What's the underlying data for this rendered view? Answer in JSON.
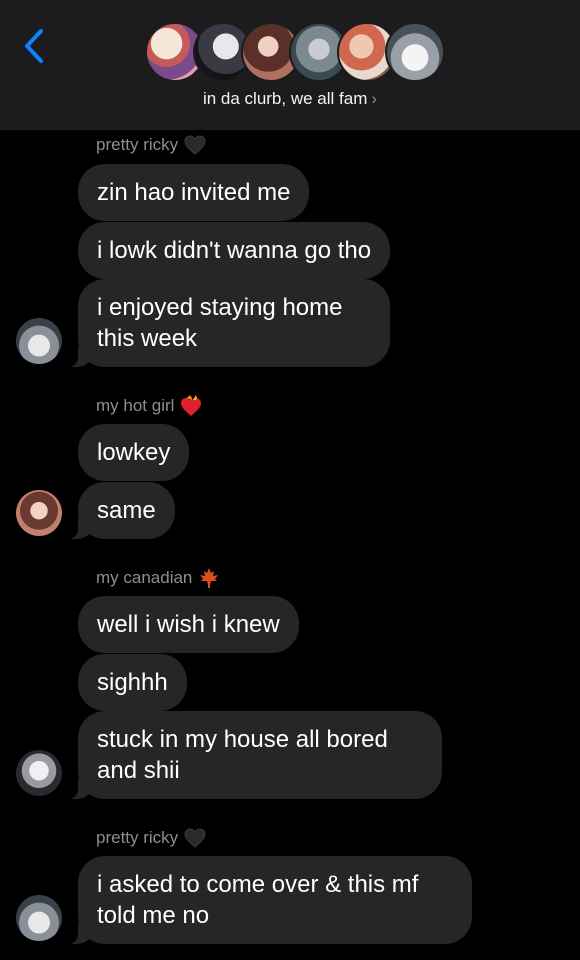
{
  "header": {
    "group_name": "in da clurb, we all fam",
    "chevron": "›",
    "back_icon": "chevron-left-icon",
    "accent_color": "#0a84ff"
  },
  "group_avatars": [
    {
      "name": "avatar-1"
    },
    {
      "name": "avatar-2"
    },
    {
      "name": "avatar-3"
    },
    {
      "name": "avatar-4"
    },
    {
      "name": "avatar-5"
    },
    {
      "name": "avatar-6"
    }
  ],
  "messages": {
    "g1": {
      "sender": "pretty ricky",
      "emoji": "black-heart-icon",
      "bubbles": [
        "zin hao invited me",
        "i lowk didn't wanna go tho",
        "i enjoyed staying home this week"
      ]
    },
    "g2": {
      "sender": "my hot girl",
      "emoji": "heart-on-fire-icon",
      "bubbles": [
        "lowkey",
        "same"
      ]
    },
    "g3": {
      "sender": "my canadian",
      "emoji": "maple-leaf-icon",
      "bubbles": [
        "well i wish i knew",
        "sighhh",
        "stuck in my house all bored and shii"
      ]
    },
    "g4": {
      "sender": "pretty ricky",
      "emoji": "black-heart-icon",
      "bubbles": [
        "i asked to come over & this mf told me no"
      ]
    }
  },
  "colors": {
    "background": "#000000",
    "header_bg": "#1c1c1e",
    "bubble_bg": "#262628",
    "sender_text": "#8e8e93"
  }
}
